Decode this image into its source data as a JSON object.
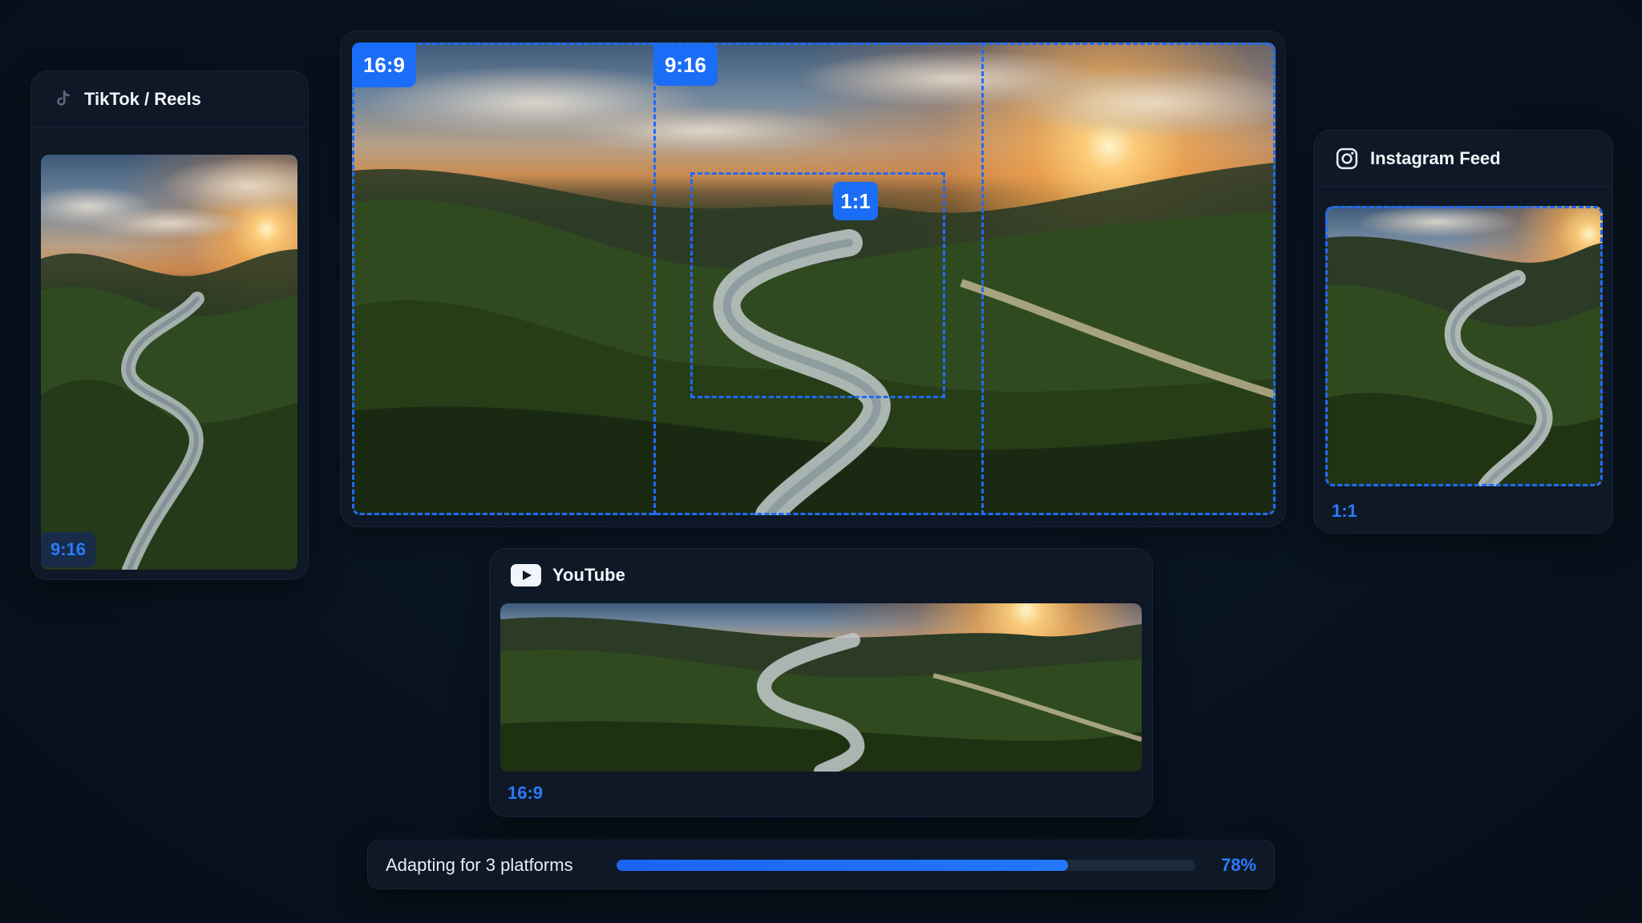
{
  "main_preview": {
    "tag_16_9": "16:9",
    "tag_9_16": "9:16",
    "tag_1_1": "1:1"
  },
  "tiktok_card": {
    "title": "TikTok / Reels",
    "icon": "tiktok-icon",
    "ratio": "9:16"
  },
  "instagram_card": {
    "title": "Instagram Feed",
    "icon": "instagram-icon",
    "ratio": "1:1"
  },
  "youtube_card": {
    "title": "YouTube",
    "icon": "youtube-icon",
    "ratio": "16:9"
  },
  "progress": {
    "label": "Adapting for 3 platforms",
    "percent_text": "78%",
    "value": 0.78
  },
  "colors": {
    "accent": "#1a6df6",
    "background": "#08121e",
    "card": "#0e1826"
  }
}
